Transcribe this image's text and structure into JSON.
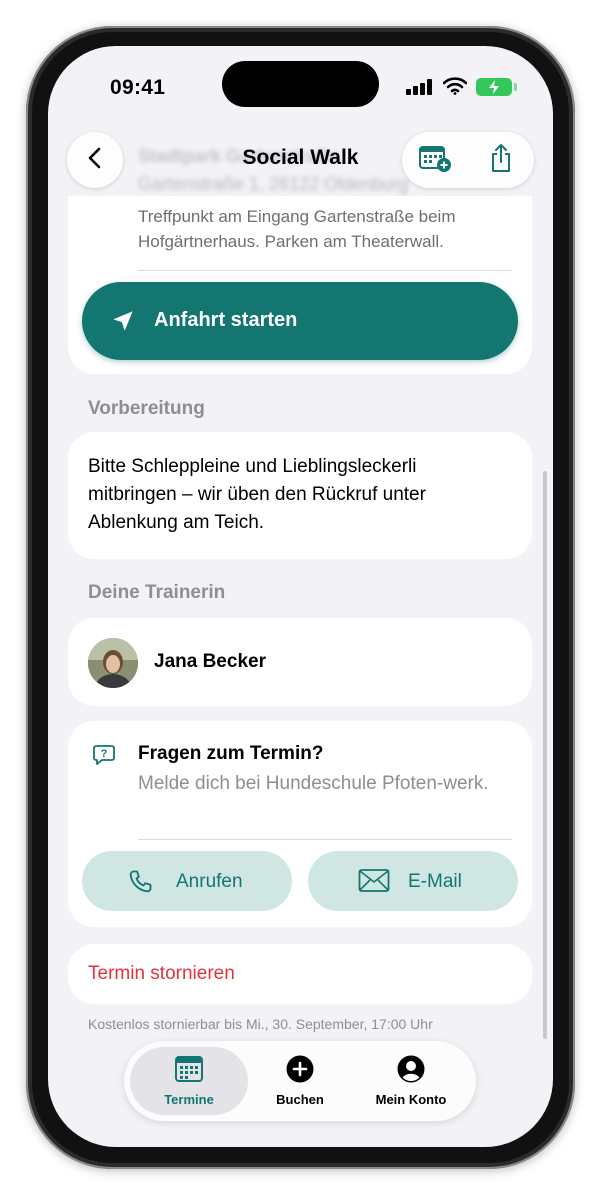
{
  "status_bar": {
    "time": "09:41"
  },
  "nav": {
    "title": "Social Walk",
    "back_label": "Zurück",
    "add_calendar_label": "Zum Kalender hinzufügen",
    "share_label": "Teilen"
  },
  "location": {
    "name": "Stadtpark Gartenstraße",
    "address": "Gartenstraße 1, 26122 Oldenburg",
    "meeting_point": "Treffpunkt am Eingang Gartenstraße beim Hofgärtnerhaus. Parken am Theaterwall.",
    "route_button": "Anfahrt starten"
  },
  "preparation": {
    "heading": "Vorbereitung",
    "text": "Bitte Schleppleine und Lieblingsleckerli mitbringen – wir üben den Rückruf unter Ablenkung am Teich."
  },
  "trainer": {
    "heading": "Deine Trainerin",
    "name": "Jana Becker"
  },
  "questions": {
    "title": "Fragen zum Termin?",
    "subtitle": "Melde dich bei Hundeschule Pfoten-werk.",
    "call_button": "Anrufen",
    "email_button": "E-Mail"
  },
  "cancel": {
    "button": "Termin stornieren",
    "note": "Kostenlos stornierbar bis Mi., 30. September, 17:00 Uhr"
  },
  "tabbar": {
    "tabs": [
      {
        "label": "Termine",
        "icon": "calendar-icon",
        "active": true
      },
      {
        "label": "Buchen",
        "icon": "plus-circle-icon",
        "active": false
      },
      {
        "label": "Mein Konto",
        "icon": "person-circle-icon",
        "active": false
      }
    ]
  },
  "colors": {
    "accent": "#137670",
    "accent_light": "#cfe6e3",
    "destructive": "#e5333b",
    "background": "#f2f2f7",
    "battery": "#34c759"
  }
}
